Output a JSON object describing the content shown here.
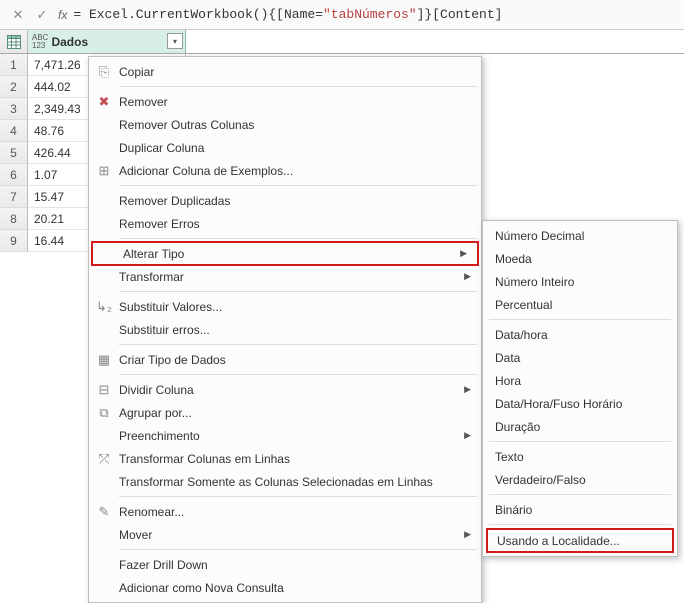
{
  "formula": {
    "prefix": "= Excel.CurrentWorkbook(){[Name=",
    "string": "\"tabNúmeros\"",
    "suffix": "]}[Content]"
  },
  "column": {
    "typeBadgeTop": "ABC",
    "typeBadgeBot": "123",
    "name": "Dados",
    "dropdownGlyph": "▾"
  },
  "rows": [
    {
      "n": "1",
      "v": "7,471.26"
    },
    {
      "n": "2",
      "v": "444.02"
    },
    {
      "n": "3",
      "v": "2,349.43"
    },
    {
      "n": "4",
      "v": "48.76"
    },
    {
      "n": "5",
      "v": "426.44"
    },
    {
      "n": "6",
      "v": "1.07"
    },
    {
      "n": "7",
      "v": "15.47"
    },
    {
      "n": "8",
      "v": "20.21"
    },
    {
      "n": "9",
      "v": "16.44"
    }
  ],
  "fxLabel": "fx",
  "xGlyph": "✕",
  "checkGlyph": "✓",
  "menu": {
    "copiar": "Copiar",
    "remover": "Remover",
    "removerOutras": "Remover Outras Colunas",
    "duplicar": "Duplicar Coluna",
    "addExemplos": "Adicionar Coluna de Exemplos...",
    "removerDup": "Remover Duplicadas",
    "removerErros": "Remover Erros",
    "alterarTipo": "Alterar Tipo",
    "transformar": "Transformar",
    "substValores": "Substituir Valores...",
    "substErros": "Substituir erros...",
    "criarTipo": "Criar Tipo de Dados",
    "dividir": "Dividir Coluna",
    "agrupar": "Agrupar por...",
    "preench": "Preenchimento",
    "transfLinhas": "Transformar Colunas em Linhas",
    "transfSel": "Transformar Somente as Colunas Selecionadas em Linhas",
    "renomear": "Renomear...",
    "mover": "Mover",
    "drillDown": "Fazer Drill Down",
    "addNova": "Adicionar como Nova Consulta"
  },
  "submenu": {
    "decimal": "Número Decimal",
    "moeda": "Moeda",
    "inteiro": "Número Inteiro",
    "percentual": "Percentual",
    "datahora": "Data/hora",
    "data": "Data",
    "hora": "Hora",
    "dhfuso": "Data/Hora/Fuso Horário",
    "duracao": "Duração",
    "texto": "Texto",
    "vf": "Verdadeiro/Falso",
    "binario": "Binário",
    "local": "Usando a Localidade..."
  },
  "arrowGlyph": "▶"
}
